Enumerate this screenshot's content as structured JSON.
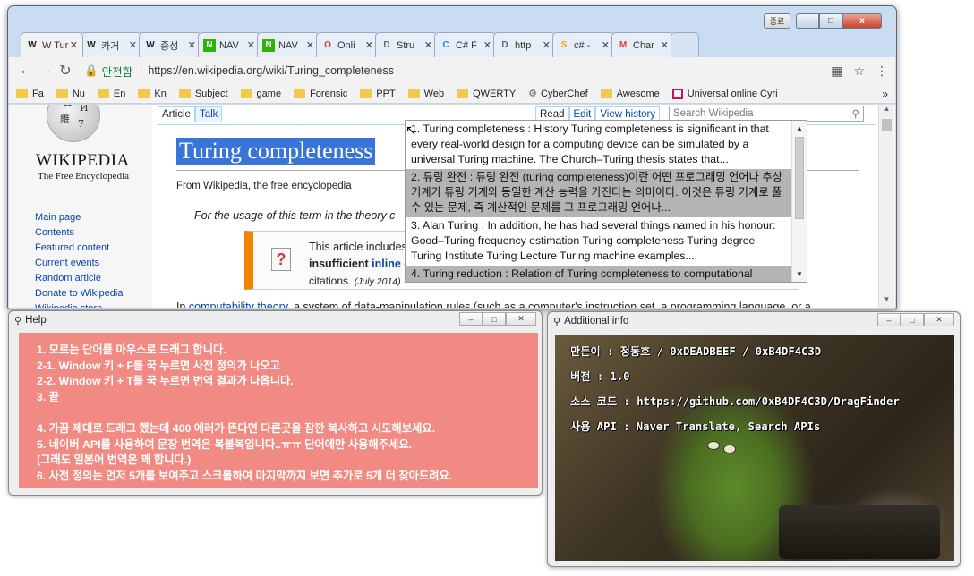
{
  "browser": {
    "title_controls": {
      "lang": "종료",
      "min": "–",
      "max": "□",
      "close": "x"
    },
    "tabs": [
      {
        "icon": "W",
        "label": "W Turir",
        "active": true
      },
      {
        "icon": "W",
        "label": "카거"
      },
      {
        "icon": "W",
        "label": "중성"
      },
      {
        "icon": "N",
        "label": "NAV"
      },
      {
        "icon": "N",
        "label": "NAV"
      },
      {
        "icon": "O",
        "label": "Onli"
      },
      {
        "icon": "D",
        "label": "Stru"
      },
      {
        "icon": "C",
        "label": "C# F"
      },
      {
        "icon": "D",
        "label": "http"
      },
      {
        "icon": "S",
        "label": "c# -"
      },
      {
        "icon": "M",
        "label": "Char"
      }
    ],
    "address": {
      "secure_label": "안전함",
      "url": "https://en.wikipedia.org/wiki/Turing_completeness"
    },
    "bookmarks": [
      "Fa",
      "Nu",
      "En",
      "Kn",
      "Subject",
      "game",
      "Forensic",
      "PPT",
      "Web",
      "QWERTY",
      "CyberChef",
      "Awesome",
      "Universal online Cyri"
    ],
    "bookmarks_more": "»"
  },
  "wiki": {
    "logo_word": "WIKIPEDIA",
    "logo_tagline": "The Free Encyclopedia",
    "nav": [
      "Main page",
      "Contents",
      "Featured content",
      "Current events",
      "Random article",
      "Donate to Wikipedia",
      "Wikipedia store"
    ],
    "tabs_left": [
      "Article",
      "Talk"
    ],
    "tabs_right": [
      "Read",
      "Edit",
      "View history"
    ],
    "search_placeholder": "Search Wikipedia",
    "title": "Turing completeness",
    "from": "From Wikipedia, the free encyclopedia",
    "hatnote": "For the usage of this term in the theory c",
    "ambox": {
      "line1": "This article includes",
      "line2_bold": "insufficient ",
      "line2_link": "inline c",
      "line3": "citations.",
      "line3_date": "(July 2014)"
    },
    "body_start": "In ",
    "body_link": "computability theory",
    "body_rest": ", a system of data-manipulation rules (such as a computer's instruction set, a programming language, or a"
  },
  "dictionary": [
    {
      "text": "1. Turing completeness : History Turing completeness is significant in that every real-world design for a computing device can be simulated by a universal Turing machine. The Church–Turing thesis states that...",
      "highlight": false
    },
    {
      "text": "2. 튜링 완전 : 튜링 완전 (turing completeness)이란 어떤 프로그래밍 언어나 추상 기계가 튜링 기계와 동일한 계산 능력을 가진다는 의미이다. 이것은 튜링 기계로 풀 수 있는 문제, 즉 계산적인 문제를 그 프로그래밍 언어나...",
      "highlight": true
    },
    {
      "text": "3. Alan Turing : In addition, he has had several things named in his honour: Good–Turing frequency estimation Turing completeness Turing degree Turing Institute Turing Lecture Turing machine examples...",
      "highlight": false
    },
    {
      "text": "4. Turing reduction : Relation of Turing completeness to computational",
      "highlight": true
    }
  ],
  "help": {
    "title": "Help",
    "lines": [
      "1. 모르는 단어를 마우스로 드래그 합니다.",
      "2-1. Window 키 + F를 꾹 누르면 사전 정의가 나오고",
      "2-2. Window 키 + T를 꾹 누르면 번역 결과가 나옵니다.",
      "3. 끝",
      "",
      "4. 가끔 제대로 드래그 했는데 400 에러가 뜬다면 다른곳을 잠깐 복사하고 시도해보세요.",
      "5. 네이버 API를 사용하여 문장 번역은 복불복입니다..ㅠㅠ 단어에만 사용해주세요.",
      "(그래도 일본어 번역은 꽤 합니다.)",
      "6. 사전 정의는 먼저 5개를 보여주고 스크롤하여 마지막까지 보면 추가로 5개 더 찾아드려요."
    ]
  },
  "additional_info": {
    "title": "Additional info",
    "lines": [
      "만든이 : 정동호 / 0xDEADBEEF / 0xB4DF4C3D",
      "버전 : 1.0",
      "소스 코드 : https://github.com/0xB4DF4C3D/DragFinder",
      "사용 API : Naver Translate, Search APIs"
    ]
  }
}
